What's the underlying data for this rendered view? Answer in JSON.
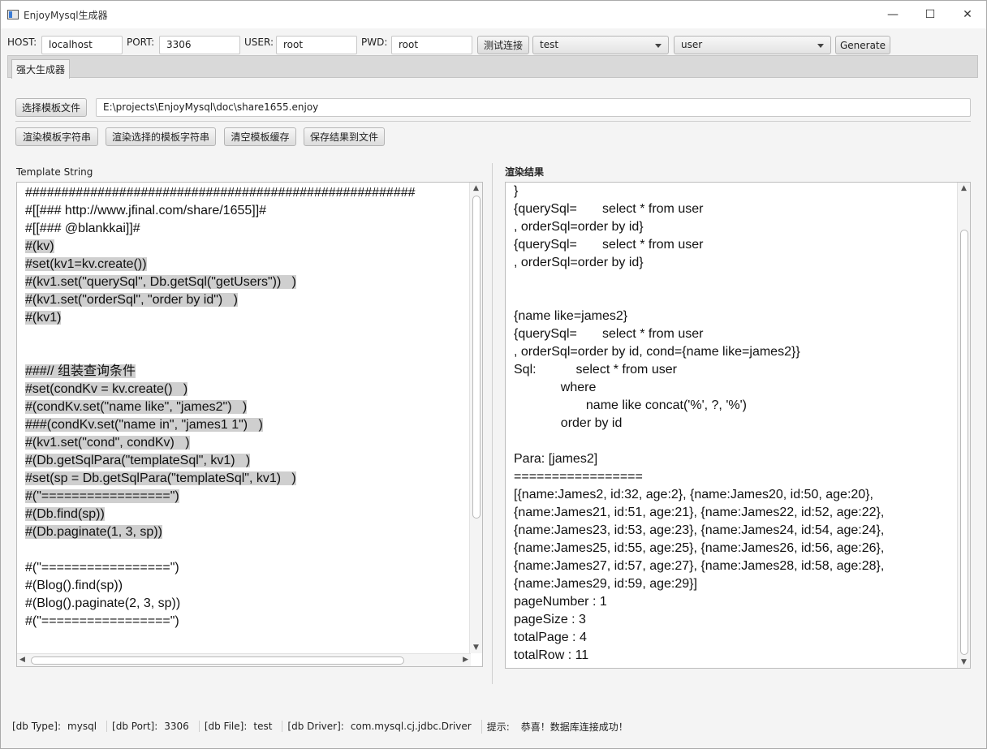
{
  "window": {
    "title": "EnjoyMysql生成器",
    "minimize": "—",
    "maximize": "☐",
    "close": "✕"
  },
  "connection": {
    "host_label": "HOST:",
    "host_value": "localhost",
    "port_label": "PORT:",
    "port_value": "3306",
    "user_label": "USER:",
    "user_value": "root",
    "pwd_label": "PWD:",
    "pwd_value": "root",
    "test_button": "测试连接",
    "database_select": "test",
    "table_select": "user",
    "generate_button": "Generate"
  },
  "tabs": [
    {
      "label": "强大生成器",
      "active": true
    }
  ],
  "template": {
    "choose_button": "选择模板文件",
    "path": "E:\\projects\\EnjoyMysql\\doc\\share1655.enjoy",
    "render_button": "渲染模板字符串",
    "render_selected_button": "渲染选择的模板字符串",
    "clear_cache_button": "清空模板缓存",
    "save_button": "保存结果到文件",
    "editor_label": "Template String",
    "result_label": "渲染结果"
  },
  "template_lines": [
    {
      "text": "######################################################",
      "hl": false
    },
    {
      "text": "#[[### http://www.jfinal.com/share/1655]]#",
      "hl": false
    },
    {
      "text": "#[[### @blankkai]]#",
      "hl": false
    },
    {
      "text": "#(kv)",
      "hl": true
    },
    {
      "text": "#set(kv1=kv.create())",
      "hl": true
    },
    {
      "text": "#(kv1.set(\"querySql\", Db.getSql(\"getUsers\"))   )",
      "hl": true
    },
    {
      "text": "#(kv1.set(\"orderSql\", \"order by id\")   )",
      "hl": true
    },
    {
      "text": "#(kv1)",
      "hl": true
    },
    {
      "text": "",
      "hl": false
    },
    {
      "text": "",
      "hl": false
    },
    {
      "text": "###// 组装查询条件",
      "hl": true
    },
    {
      "text": "#set(condKv = kv.create()   )",
      "hl": true
    },
    {
      "text": "#(condKv.set(\"name like\", \"james2\")   )",
      "hl": true
    },
    {
      "text": "###(condKv.set(\"name in\", \"james1 1\")   )",
      "hl": true
    },
    {
      "text": "#(kv1.set(\"cond\", condKv)   )",
      "hl": true
    },
    {
      "text": "#(Db.getSqlPara(\"templateSql\", kv1)   )",
      "hl": true
    },
    {
      "text": "#set(sp = Db.getSqlPara(\"templateSql\", kv1)   )",
      "hl": true
    },
    {
      "text": "#(\"=================\")",
      "hl": true
    },
    {
      "text": "#(Db.find(sp))",
      "hl": true
    },
    {
      "text": "#(Db.paginate(1, 3, sp))",
      "hl": true
    },
    {
      "text": "",
      "hl": false
    },
    {
      "text": "#(\"=================\")",
      "hl": false
    },
    {
      "text": "#(Blog().find(sp))",
      "hl": false
    },
    {
      "text": "#(Blog().paginate(2, 3, sp))",
      "hl": false
    },
    {
      "text": "#(\"=================\")",
      "hl": false
    }
  ],
  "result_lines": [
    "}",
    "{querySql=       select * from user",
    ", orderSql=order by id}",
    "{querySql=       select * from user",
    ", orderSql=order by id}",
    "",
    "",
    "{name like=james2}",
    "{querySql=       select * from user",
    ", orderSql=order by id, cond={name like=james2}}",
    "Sql:           select * from user",
    "             where",
    "                    name like concat('%', ?, '%')",
    "             order by id",
    "",
    "Para: [james2]",
    "=================",
    "[{name:James2, id:32, age:2}, {name:James20, id:50, age:20},",
    "{name:James21, id:51, age:21}, {name:James22, id:52, age:22},",
    "{name:James23, id:53, age:23}, {name:James24, id:54, age:24},",
    "{name:James25, id:55, age:25}, {name:James26, id:56, age:26},",
    "{name:James27, id:57, age:27}, {name:James28, id:58, age:28},",
    "{name:James29, id:59, age:29}]",
    "pageNumber : 1",
    "pageSize : 3",
    "totalPage : 4",
    "totalRow : 11"
  ],
  "status": {
    "db_type_label": "[db Type]:",
    "db_type": "mysql",
    "db_port_label": "[db Port]:",
    "db_port": "3306",
    "db_file_label": "[db File]:",
    "db_file": "test",
    "db_driver_label": "[db Driver]:",
    "db_driver": "com.mysql.cj.jdbc.Driver",
    "hint_label": "提示:",
    "hint": "恭喜！数据库连接成功！"
  }
}
